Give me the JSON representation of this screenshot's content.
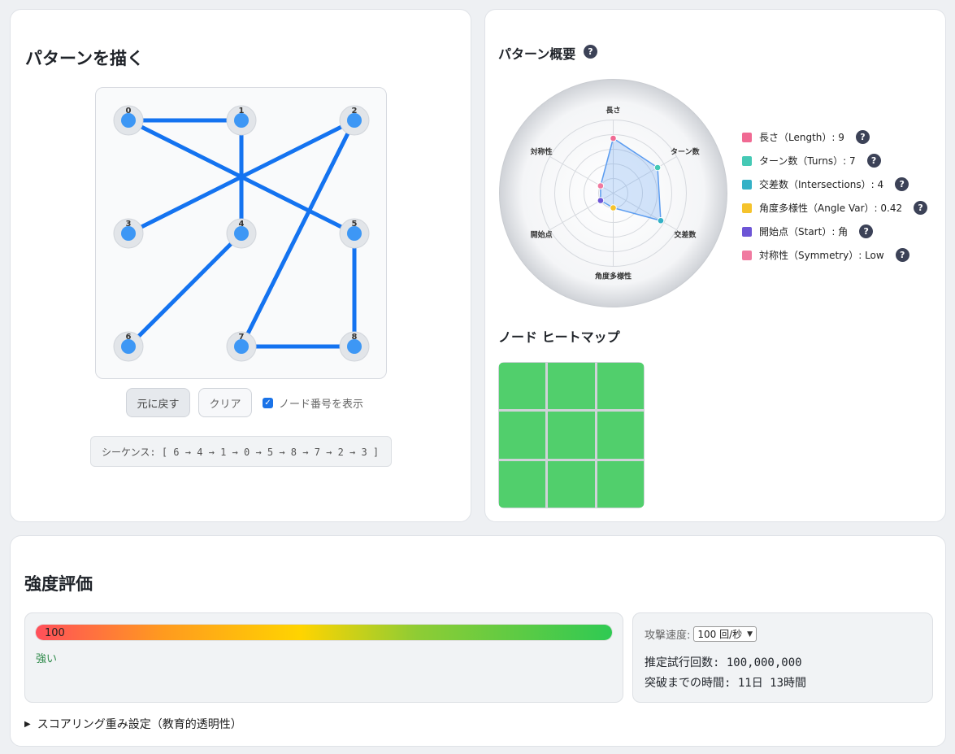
{
  "draw": {
    "title": "パターンを描く",
    "node_labels": [
      "0",
      "1",
      "2",
      "3",
      "4",
      "5",
      "6",
      "7",
      "8"
    ],
    "sequence": [
      6,
      4,
      1,
      0,
      5,
      8,
      7,
      2,
      3
    ],
    "undo_label": "元に戻す",
    "clear_label": "クリア",
    "show_numbers_label": "ノード番号を表示",
    "show_numbers_checked": true,
    "sequence_text": "シーケンス: [ 6 → 4 → 1 → 0 → 5 → 8 → 7 → 2 → 3 ]",
    "line_color": "#1473f0",
    "node_color": "#3d97f5"
  },
  "summary": {
    "title": "パターン概要",
    "help": "?",
    "radar_axes": [
      "長さ",
      "ターン数",
      "交差数",
      "角度多様性",
      "開始点",
      "対称性"
    ],
    "radar_values": [
      0.75,
      0.7,
      0.75,
      0.2,
      0.2,
      0.2
    ],
    "legend": [
      {
        "text": "長さ（Length）: 9",
        "color": "#f06a93"
      },
      {
        "text": "ターン数（Turns）: 7",
        "color": "#45c9b5"
      },
      {
        "text": "交差数（Intersections）: 4",
        "color": "#34b1c6"
      },
      {
        "text": "角度多様性（Angle Var）: 0.42",
        "color": "#f5c32c"
      },
      {
        "text": "開始点（Start）: 角",
        "color": "#6d55d6"
      },
      {
        "text": "対称性（Symmetry）: Low",
        "color": "#f07aa0"
      }
    ]
  },
  "heatmap": {
    "title": "ノード ヒートマップ",
    "cell_color": "#51cf6c"
  },
  "strength": {
    "title": "強度評価",
    "score": "100",
    "score_fraction": 1.0,
    "label": "強い",
    "attack_speed_label": "攻撃速度:",
    "attack_speed_value": "100 回/秒",
    "guesses_text": "推定試行回数: 100,000,000",
    "time_text": "突破までの時間: 11日 13時間",
    "weights_toggle": "スコアリング重み設定（教育的透明性）"
  }
}
